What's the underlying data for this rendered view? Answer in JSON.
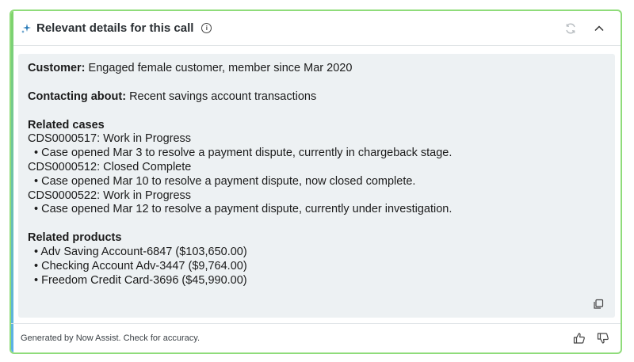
{
  "header": {
    "title": "Relevant details for this call",
    "info_glyph": "i",
    "icons": [
      "sparkle-icon",
      "info-icon",
      "refresh-icon",
      "chevron-up-icon"
    ]
  },
  "summary": {
    "customer_label": "Customer:",
    "customer_value": "Engaged female customer, member since Mar 2020",
    "contacting_label": "Contacting about:",
    "contacting_value": "Recent savings account transactions",
    "related_cases_heading": "Related cases",
    "cases": [
      {
        "title": "CDS0000517: Work in Progress",
        "detail": "Case opened Mar 3 to resolve a payment dispute, currently in chargeback stage."
      },
      {
        "title": "CDS0000512: Closed Complete",
        "detail": "Case opened Mar 10 to resolve a payment dispute, now closed complete."
      },
      {
        "title": "CDS0000522: Work in Progress",
        "detail": "Case opened Mar 12 to resolve a payment dispute, currently under investigation."
      }
    ],
    "related_products_heading": "Related products",
    "products": [
      "Adv Saving Account-6847 ($103,650.00)",
      "Checking Account Adv-3447 ($9,764.00)",
      "Freedom Credit Card-3696 ($45,990.00)"
    ],
    "bullet": "•"
  },
  "footer": {
    "disclaimer": "Generated by Now Assist. Check for accuracy."
  },
  "colors": {
    "border": "#8fdc7a",
    "content_bg": "#edf1f3",
    "accent": "#2a7bb8"
  }
}
